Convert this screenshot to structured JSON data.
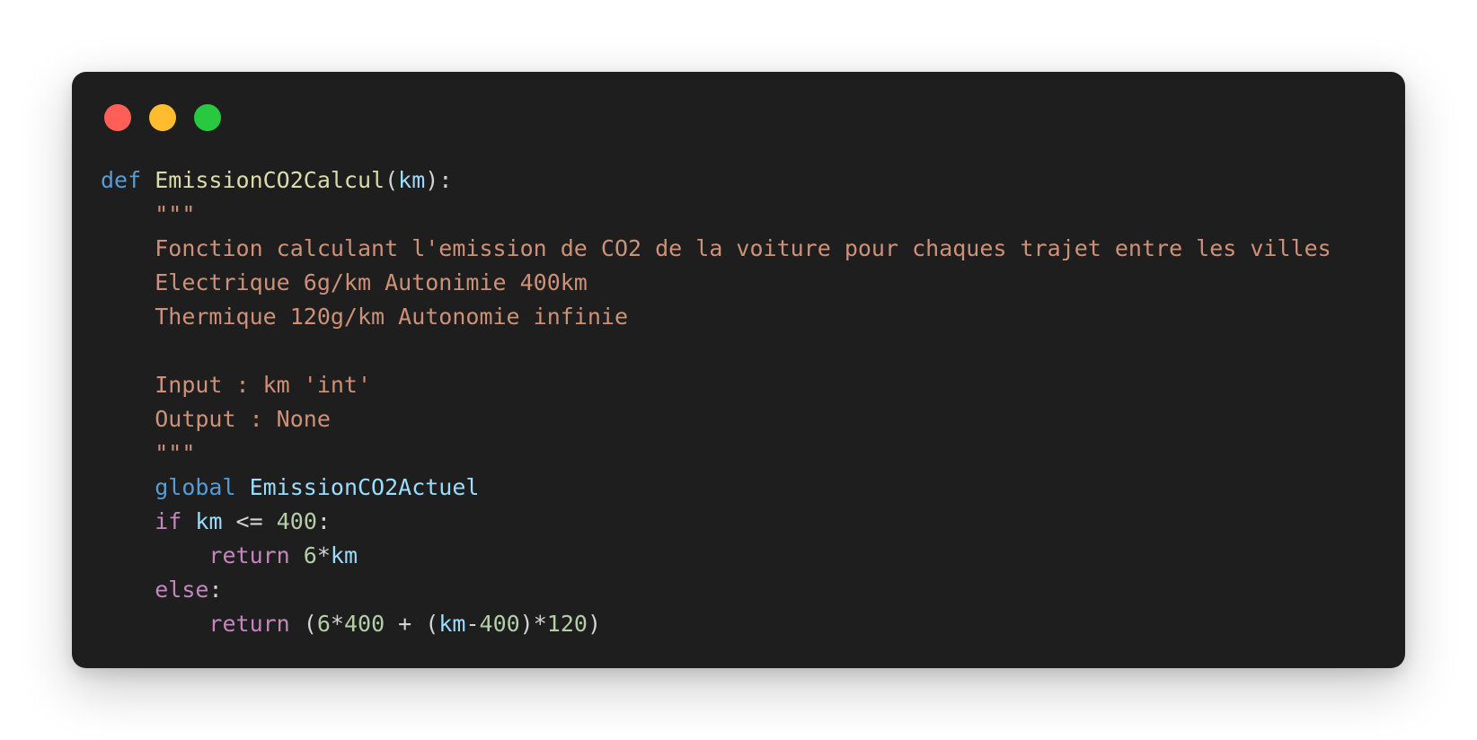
{
  "window": {
    "controls": {
      "close_color": "#ff5f57",
      "minimize_color": "#febc2e",
      "maximize_color": "#28c840"
    }
  },
  "code": {
    "language": "python",
    "lines": [
      {
        "tokens": [
          [
            "def",
            "kw"
          ],
          [
            " ",
            "op"
          ],
          [
            "EmissionCO2Calcul",
            "fn"
          ],
          [
            "(",
            "op"
          ],
          [
            "km",
            "var"
          ],
          [
            "):",
            "op"
          ]
        ]
      },
      {
        "tokens": [
          [
            "    ",
            "op"
          ],
          [
            "\"\"\"",
            "str"
          ]
        ]
      },
      {
        "tokens": [
          [
            "    ",
            "op"
          ],
          [
            "Fonction calculant l'emission de CO2 de la voiture pour chaques trajet entre les villes",
            "str"
          ]
        ]
      },
      {
        "tokens": [
          [
            "    ",
            "op"
          ],
          [
            "Electrique 6g/km Autonimie 400km",
            "str"
          ]
        ]
      },
      {
        "tokens": [
          [
            "    ",
            "op"
          ],
          [
            "Thermique 120g/km Autonomie infinie",
            "str"
          ]
        ]
      },
      {
        "tokens": [
          [
            "",
            "op"
          ]
        ]
      },
      {
        "tokens": [
          [
            "    ",
            "op"
          ],
          [
            "Input : km 'int'",
            "str"
          ]
        ]
      },
      {
        "tokens": [
          [
            "    ",
            "op"
          ],
          [
            "Output : None",
            "str"
          ]
        ]
      },
      {
        "tokens": [
          [
            "    ",
            "op"
          ],
          [
            "\"\"\"",
            "str"
          ]
        ]
      },
      {
        "tokens": [
          [
            "    ",
            "op"
          ],
          [
            "global",
            "kw"
          ],
          [
            " ",
            "op"
          ],
          [
            "EmissionCO2Actuel",
            "var"
          ]
        ]
      },
      {
        "tokens": [
          [
            "    ",
            "op"
          ],
          [
            "if",
            "ctrl"
          ],
          [
            " ",
            "op"
          ],
          [
            "km",
            "var"
          ],
          [
            " <= ",
            "op"
          ],
          [
            "400",
            "num"
          ],
          [
            ":",
            "op"
          ]
        ]
      },
      {
        "tokens": [
          [
            "        ",
            "op"
          ],
          [
            "return",
            "ctrl"
          ],
          [
            " ",
            "op"
          ],
          [
            "6",
            "num"
          ],
          [
            "*",
            "op"
          ],
          [
            "km",
            "var"
          ]
        ]
      },
      {
        "tokens": [
          [
            "    ",
            "op"
          ],
          [
            "else",
            "ctrl"
          ],
          [
            ":",
            "op"
          ]
        ]
      },
      {
        "tokens": [
          [
            "        ",
            "op"
          ],
          [
            "return",
            "ctrl"
          ],
          [
            " (",
            "op"
          ],
          [
            "6",
            "num"
          ],
          [
            "*",
            "op"
          ],
          [
            "400",
            "num"
          ],
          [
            " + (",
            "op"
          ],
          [
            "km",
            "var"
          ],
          [
            "-",
            "op"
          ],
          [
            "400",
            "num"
          ],
          [
            ")*",
            "op"
          ],
          [
            "120",
            "num"
          ],
          [
            ")",
            "op"
          ]
        ]
      }
    ]
  }
}
